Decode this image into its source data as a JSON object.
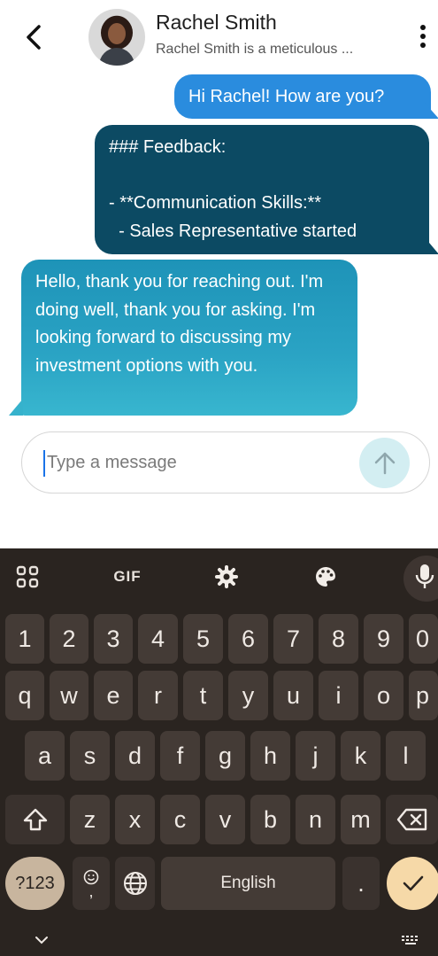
{
  "header": {
    "contact_name": "Rachel Smith",
    "contact_subtitle": "Rachel Smith is a meticulous ..."
  },
  "messages": [
    {
      "sender": "user",
      "text": "Hi Rachel! How are you?"
    },
    {
      "sender": "user",
      "text": "### Feedback:\n\n- **Communication Skills:**\n  - Sales Representative started"
    },
    {
      "sender": "contact",
      "text": "Hello, thank you for reaching out. I'm doing well, thank you for asking. I'm looking forward to discussing my investment options with you."
    }
  ],
  "composer": {
    "placeholder": "Type a message",
    "value": ""
  },
  "keyboard": {
    "toolbar": {
      "gif_label": "GIF"
    },
    "number_row": [
      "1",
      "2",
      "3",
      "4",
      "5",
      "6",
      "7",
      "8",
      "9",
      "0"
    ],
    "row1": [
      "q",
      "w",
      "e",
      "r",
      "t",
      "y",
      "u",
      "i",
      "o",
      "p"
    ],
    "row2": [
      "a",
      "s",
      "d",
      "f",
      "g",
      "h",
      "j",
      "k",
      "l"
    ],
    "row3": [
      "z",
      "x",
      "c",
      "v",
      "b",
      "n",
      "m"
    ],
    "symbols_label": "?123",
    "emoji_comma_label": ",",
    "space_label": "English",
    "period_label": "."
  },
  "colors": {
    "user_bubble": "#2a8cde",
    "feedback_bubble": "#0c4a63",
    "contact_bubble": "#1e93b8",
    "keyboard_bg": "#2a2420",
    "enter_key": "#f6d9a8"
  }
}
